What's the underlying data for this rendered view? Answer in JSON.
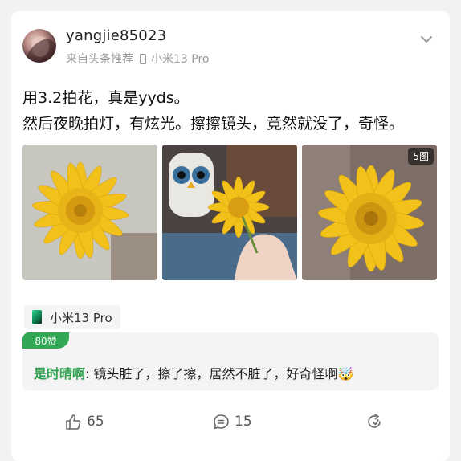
{
  "post": {
    "username": "yangjie85023",
    "source_label": "来自头条推荐",
    "device_label": "小米13 Pro",
    "lines": [
      "用3.2拍花，真是yyds。",
      "然后夜晚拍灯，有炫光。擦擦镜头，竟然就没了，奇怪。"
    ],
    "photo_count_badge": "5图",
    "device_chip_label": "小米13 Pro"
  },
  "comment": {
    "likes_badge": "80赞",
    "author": "是时晴啊",
    "separator": ": ",
    "text": "镜头脏了，擦了擦，居然不脏了，好奇怪啊🤯"
  },
  "actions": {
    "like_count": "65",
    "comment_count": "15"
  },
  "colors": {
    "accent_green": "#33a854",
    "author_green": "#2f9e4e",
    "flower_yellow": "#f2c21b"
  }
}
